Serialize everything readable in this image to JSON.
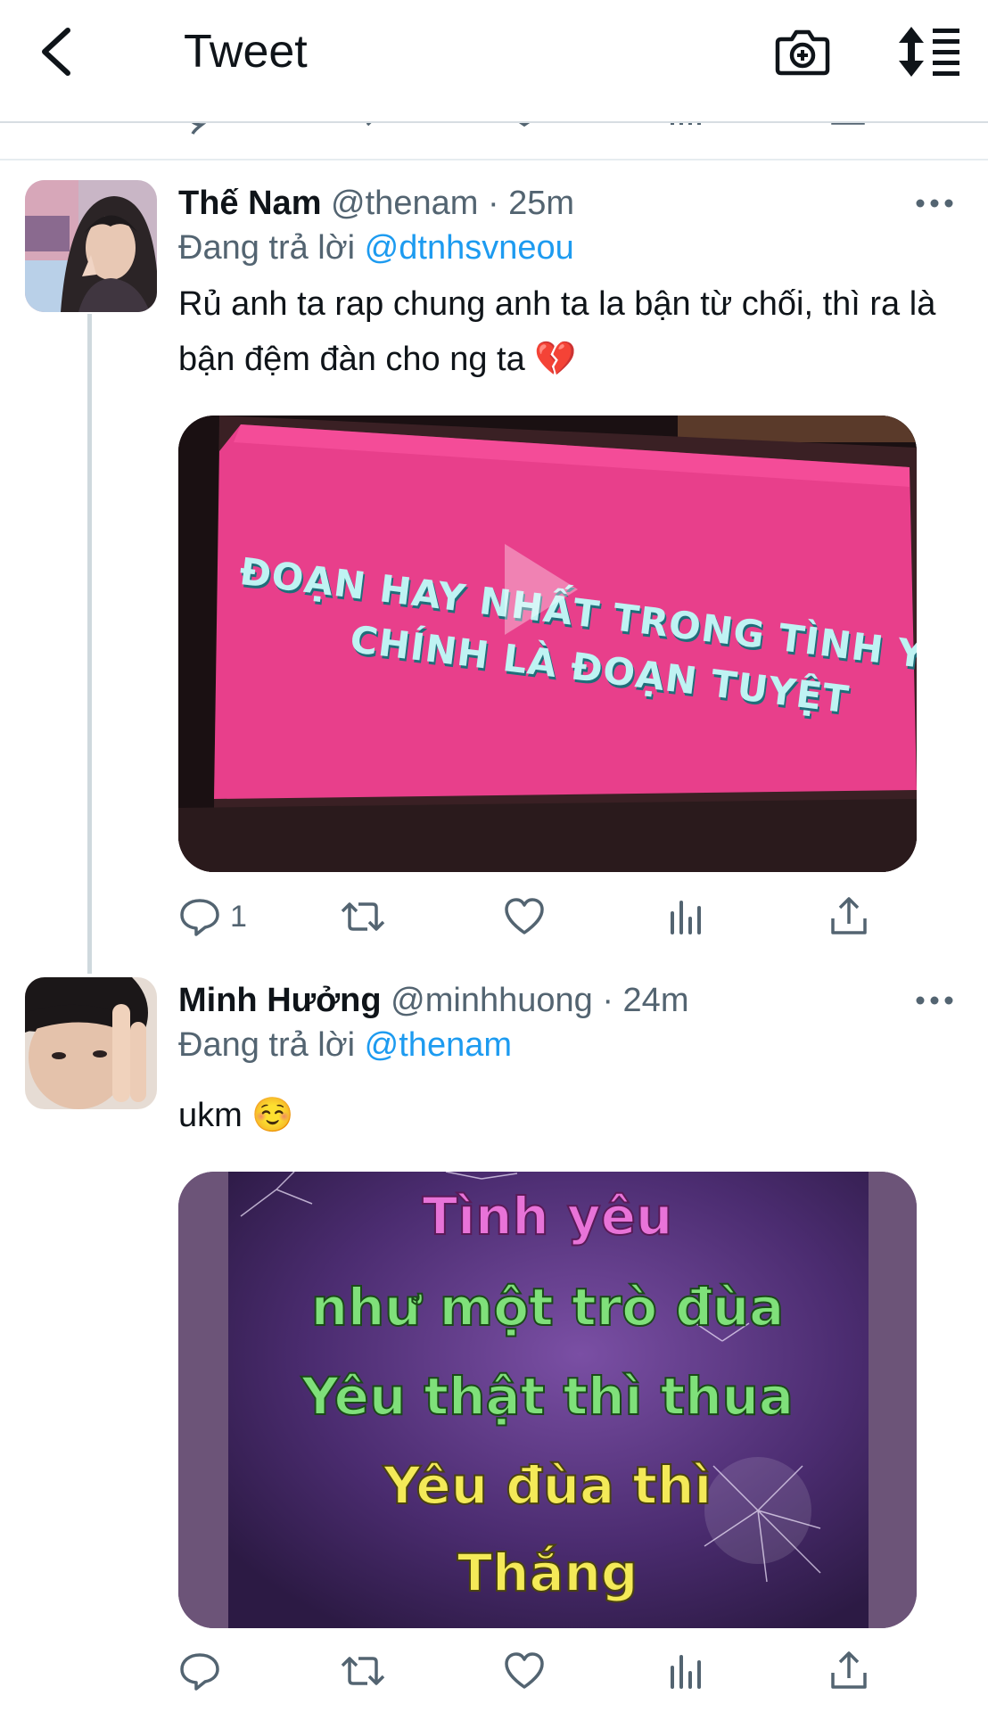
{
  "header": {
    "title": "Tweet",
    "icons": [
      "back-icon",
      "camera-icon",
      "sort-icon"
    ]
  },
  "tweets": [
    {
      "name": "Thế Nam",
      "handle": "@thenam",
      "dot": "·",
      "time": "25m",
      "reply_prefix": "Đang trả lời",
      "reply_to": "@dtnhsvneou",
      "text": "Rủ anh ta rap chung anh ta la bận từ chối, thì ra là bận đệm đàn cho ng ta 💔",
      "media": {
        "kind": "video",
        "line1": "ĐOẠN HAY NHẤT TRONG TÌNH YÊU",
        "line2": "CHÍNH LÀ ĐOẠN TUYỆT",
        "bg_color": "#e83f8b"
      },
      "reply_count": "1"
    },
    {
      "name": "Minh Hưởng",
      "handle": "@minhhuong",
      "dot": "·",
      "time": "24m",
      "reply_prefix": "Đang trả lời",
      "reply_to": "@thenam",
      "text": "ukm ☺️",
      "media": {
        "kind": "image",
        "lines": [
          "Tình yêu",
          "như một trò đùa",
          "Yêu thật thì thua",
          "Yêu đùa thì",
          "Thắng"
        ],
        "bg_color": "#4a2a6e"
      }
    }
  ],
  "colors": {
    "accent": "#1d9bf0",
    "secondary_text": "#536471",
    "icon": "#536471"
  }
}
